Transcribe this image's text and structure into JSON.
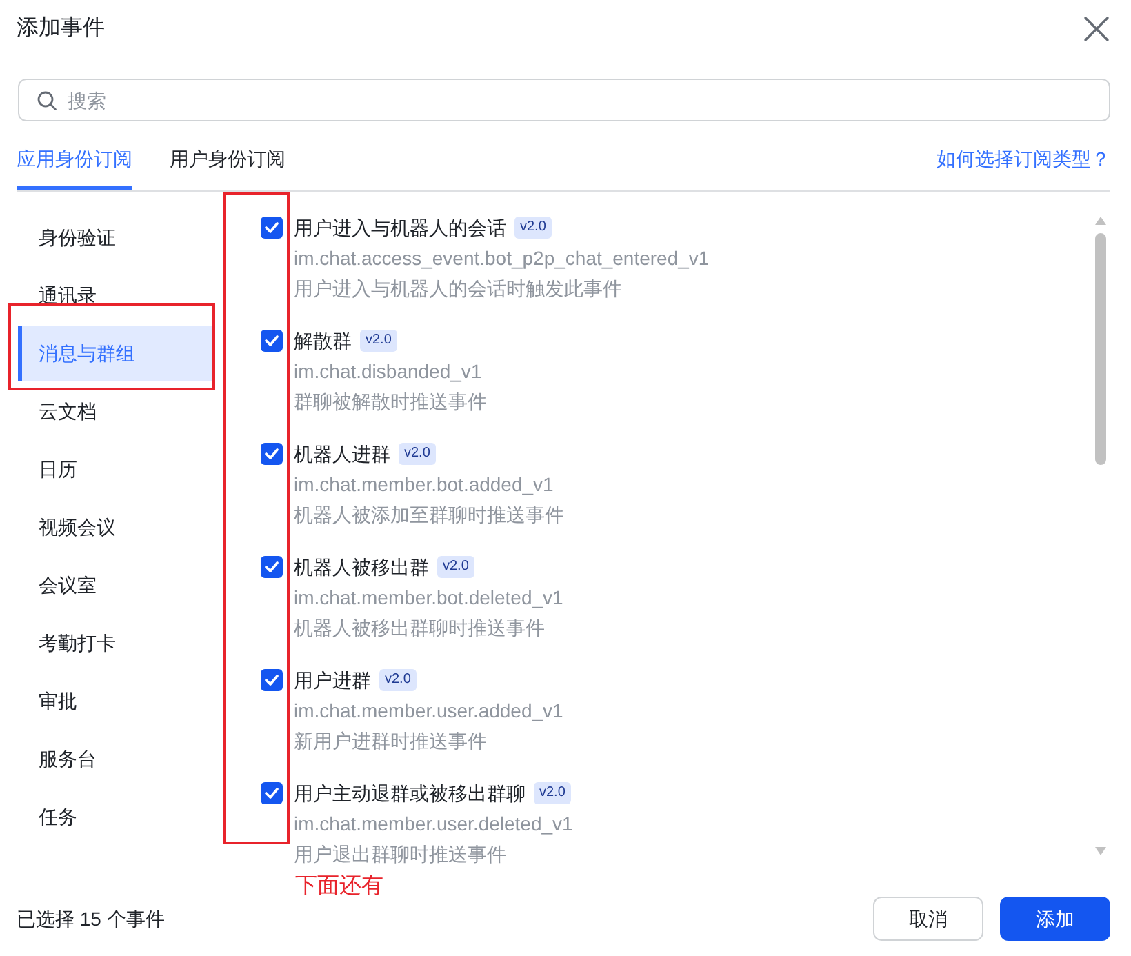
{
  "dialog": {
    "title": "添加事件"
  },
  "search": {
    "placeholder": "搜索"
  },
  "tabs": [
    {
      "label": "应用身份订阅",
      "selected": true
    },
    {
      "label": "用户身份订阅",
      "selected": false
    }
  ],
  "help_link": "如何选择订阅类型？",
  "sidebar": {
    "items": [
      {
        "label": "身份验证",
        "selected": false
      },
      {
        "label": "通讯录",
        "selected": false
      },
      {
        "label": "消息与群组",
        "selected": true
      },
      {
        "label": "云文档",
        "selected": false
      },
      {
        "label": "日历",
        "selected": false
      },
      {
        "label": "视频会议",
        "selected": false
      },
      {
        "label": "会议室",
        "selected": false
      },
      {
        "label": "考勤打卡",
        "selected": false
      },
      {
        "label": "审批",
        "selected": false
      },
      {
        "label": "服务台",
        "selected": false
      },
      {
        "label": "任务",
        "selected": false
      }
    ]
  },
  "events": [
    {
      "title": "用户进入与机器人的会话",
      "version": "v2.0",
      "code": "im.chat.access_event.bot_p2p_chat_entered_v1",
      "description": "用户进入与机器人的会话时触发此事件",
      "checked": true
    },
    {
      "title": "解散群",
      "version": "v2.0",
      "code": "im.chat.disbanded_v1",
      "description": "群聊被解散时推送事件",
      "checked": true
    },
    {
      "title": "机器人进群",
      "version": "v2.0",
      "code": "im.chat.member.bot.added_v1",
      "description": "机器人被添加至群聊时推送事件",
      "checked": true
    },
    {
      "title": "机器人被移出群",
      "version": "v2.0",
      "code": "im.chat.member.bot.deleted_v1",
      "description": "机器人被移出群聊时推送事件",
      "checked": true
    },
    {
      "title": "用户进群",
      "version": "v2.0",
      "code": "im.chat.member.user.added_v1",
      "description": "新用户进群时推送事件",
      "checked": true
    },
    {
      "title": "用户主动退群或被移出群聊",
      "version": "v2.0",
      "code": "im.chat.member.user.deleted_v1",
      "description": "用户退出群聊时推送事件",
      "checked": true
    }
  ],
  "footer": {
    "selection_summary": "已选择 15 个事件",
    "buttons": [
      {
        "label": "取消",
        "kind": "secondary"
      },
      {
        "label": "添加",
        "kind": "primary"
      }
    ]
  },
  "annotation_note": "下面还有"
}
